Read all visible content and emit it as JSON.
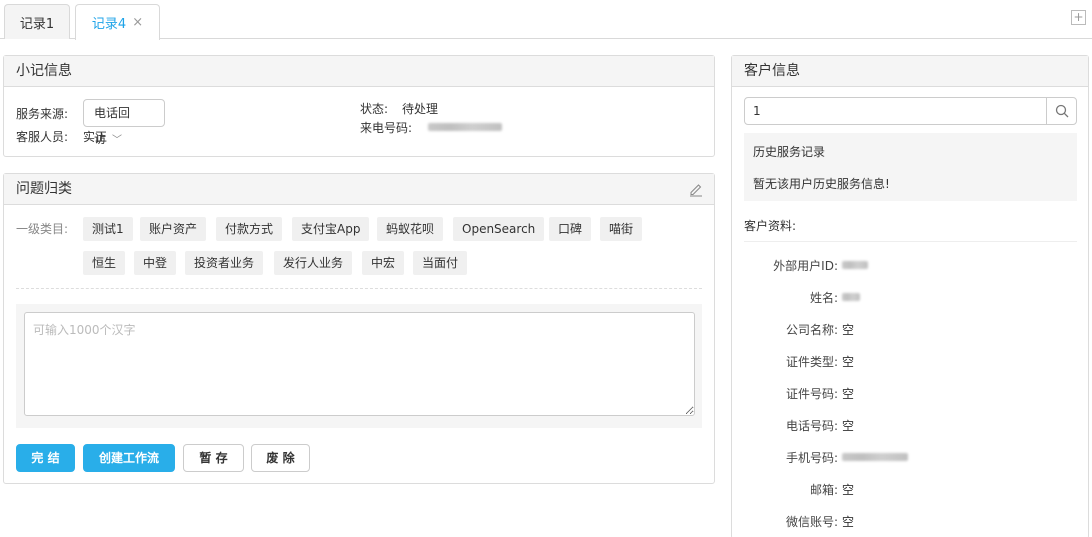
{
  "tabs": [
    {
      "label": "记录1",
      "active": false,
      "closable": false
    },
    {
      "label": "记录4",
      "active": true,
      "closable": true,
      "close_glyph": "×"
    }
  ],
  "tab_add_glyph": "+",
  "note_panel": {
    "title": "小记信息",
    "service_source_label": "服务来源:",
    "service_source_value": "电话回访",
    "agent_label": "客服人员:",
    "agent_value": "实正",
    "status_label": "状态:",
    "status_value": "待处理",
    "caller_label": "来电号码:"
  },
  "issue_panel": {
    "title": "问题归类",
    "level1_label": "一级类目:",
    "tags_row1": [
      "测试1",
      "账户资产",
      "付款方式",
      "支付宝App",
      "蚂蚁花呗",
      "OpenSearch",
      "口碑",
      "喵街"
    ],
    "tags_row2": [
      "恒生",
      "中登",
      "投资者业务",
      "发行人业务",
      "中宏",
      "当面付"
    ],
    "textarea_placeholder": "可输入1000个汉字",
    "buttons": {
      "finish": "完 结",
      "create_workflow": "创建工作流",
      "save_draft": "暂 存",
      "discard": "废 除"
    }
  },
  "customer_panel": {
    "title": "客户信息",
    "search_value": "1",
    "history_title": "历史服务记录",
    "history_empty": "暂无该用户历史服务信息!",
    "profile_label": "客户资料:",
    "fields": [
      {
        "label": "外部用户ID:",
        "value": "",
        "blurred": true
      },
      {
        "label": "姓名:",
        "value": "",
        "blurred": true
      },
      {
        "label": "公司名称:",
        "value": "空",
        "blurred": false
      },
      {
        "label": "证件类型:",
        "value": "空",
        "blurred": false
      },
      {
        "label": "证件号码:",
        "value": "空",
        "blurred": false
      },
      {
        "label": "电话号码:",
        "value": "空",
        "blurred": false
      },
      {
        "label": "手机号码:",
        "value": "",
        "blurred": true
      },
      {
        "label": "邮箱:",
        "value": "空",
        "blurred": false
      },
      {
        "label": "微信账号:",
        "value": "空",
        "blurred": false
      }
    ]
  },
  "colors": {
    "accent": "#29aee9",
    "tab_active": "#1ea3e8",
    "panel_header_bg": "#f5f5f5",
    "tag_bg": "#f0f0f0"
  }
}
